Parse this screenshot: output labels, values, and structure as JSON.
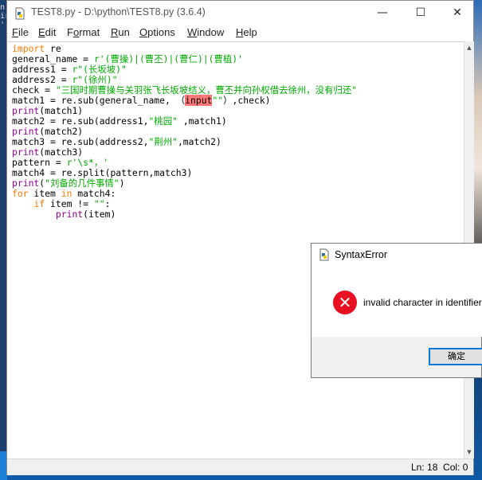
{
  "window": {
    "title": "TEST8.py - D:\\python\\TEST8.py (3.6.4)",
    "minimize": "—",
    "maximize": "☐",
    "close": "✕"
  },
  "menu": {
    "items": [
      {
        "label": "File",
        "u": "F",
        "rest": "ile"
      },
      {
        "label": "Edit",
        "u": "E",
        "rest": "dit"
      },
      {
        "label": "Format",
        "u": "o",
        "pre": "F",
        "rest": "rmat"
      },
      {
        "label": "Run",
        "u": "R",
        "rest": "un"
      },
      {
        "label": "Options",
        "u": "O",
        "rest": "ptions"
      },
      {
        "label": "Window",
        "u": "W",
        "rest": "indow"
      },
      {
        "label": "Help",
        "u": "H",
        "rest": "elp"
      }
    ]
  },
  "code": {
    "l1_kw": "import",
    "l1_rest": " re",
    "l2_a": "general_name = ",
    "l2_str": "r'(曹操)|(曹丕)|(曹仁)|(曹植)'",
    "l3_a": "address1 = ",
    "l3_str": "r\"(长坂坡)\"",
    "l4_a": "address2 = ",
    "l4_str": "r\"(徐州)\"",
    "l5_a": "check = ",
    "l5_str": "\"三国时期曹操与关羽张飞长坂坡结义，曹丕并向孙权借去徐州，没有归还\"",
    "l6_a": "match1 = re.sub(general_name, （",
    "l6_err": "input",
    "l6_str": "\"\"",
    "l6_b": "）,check)",
    "l7_bi": "print",
    "l7_rest": "(match1)",
    "l8_a": "match2 = re.sub(address1,",
    "l8_str": "\"桃园\"",
    "l8_b": " ,match1)",
    "l9_bi": "print",
    "l9_rest": "(match2)",
    "l10_a": "match3 = re.sub(address2,",
    "l10_str": "\"荆州\"",
    "l10_b": ",match2)",
    "l11_bi": "print",
    "l11_rest": "(match3)",
    "l12_a": "pattern = ",
    "l12_str": "r'\\s*，'",
    "l13_a": "match4 = re.split(pattern,match3)",
    "l14_bi": "print",
    "l14_a": "(",
    "l14_str": "\"刘备的几件事情\"",
    "l14_b": ")",
    "l15_kw1": "for",
    "l15_a": " item ",
    "l15_kw2": "in",
    "l15_b": " match4:",
    "l16_indent": "    ",
    "l16_kw": "if",
    "l16_a": " item != ",
    "l16_str": "\"\"",
    "l16_b": ":",
    "l17_indent": "        ",
    "l17_bi": "print",
    "l17_rest": "(item)"
  },
  "status": {
    "text": "Ln: 18  Col: 0"
  },
  "dialog": {
    "title": "SyntaxError",
    "message": "invalid character in identifier",
    "icon_glyph": "✕",
    "ok_label": "确定"
  },
  "desktop": {
    "left_text": "n\nir\n'("
  }
}
